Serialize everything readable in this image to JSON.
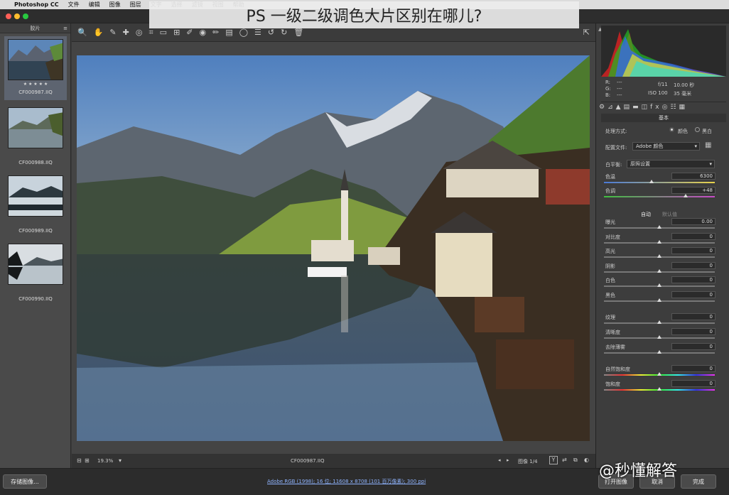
{
  "menubar": {
    "apple": "",
    "app": "Photoshop CC",
    "items": [
      "文件",
      "编辑",
      "图像",
      "图层",
      "文字",
      "选择",
      "滤镜",
      "视图",
      "帮助"
    ]
  },
  "banner": {
    "title": "PS 一级二级调色大片区别在哪儿?"
  },
  "filmstrip": {
    "header": "胶片",
    "stars": "★ ★ ★ ★ ★",
    "items": [
      {
        "label": "CF000987.IIQ",
        "selected": true
      },
      {
        "label": "CF000988.IIQ",
        "selected": false
      },
      {
        "label": "CF000989.IIQ",
        "selected": false
      },
      {
        "label": "CF000990.IIQ",
        "selected": false
      }
    ]
  },
  "toolbar": {
    "icons": [
      "zoom-icon",
      "hand-icon",
      "white-balance-icon",
      "color-sampler-icon",
      "target-adjust-icon",
      "crop-icon",
      "straighten-icon",
      "transform-icon",
      "spot-removal-icon",
      "red-eye-icon",
      "adjustment-brush-icon",
      "graduated-filter-icon",
      "radial-filter-icon",
      "preferences-icon",
      "rotate-left-icon",
      "rotate-right-icon",
      "trash-icon"
    ],
    "glyphs": [
      "🔍",
      "✋",
      "✎",
      "✚",
      "◎",
      "⌗",
      "▭",
      "⊞",
      "✐",
      "◉",
      "✏",
      "▤",
      "◯",
      "☰",
      "↺",
      "↻",
      "🗑"
    ]
  },
  "status": {
    "zoom": "19.3%",
    "filename": "CF000987.IIQ",
    "page": "图像 1/4",
    "nav_prev": "◂",
    "nav_next": "▸"
  },
  "footer": {
    "save": "存储图像...",
    "info": "Adobe RGB (1998); 16 位; 11608 x 8708 (101 百万像素); 300 ppi",
    "open": "打开图像",
    "cancel": "取消",
    "done": "完成"
  },
  "histogram": {
    "r_label": "R:",
    "g_label": "G:",
    "b_label": "B:",
    "r_val": "---",
    "g_val": "---",
    "b_val": "---",
    "aperture": "f/11",
    "shutter": "10.00 秒",
    "iso": "ISO 100",
    "focal": "35 毫米"
  },
  "panel": {
    "section": "基本",
    "process_label": "处理方式:",
    "color_opt": "颜色",
    "bw_opt": "黑白",
    "profile_label": "配置文件:",
    "profile_value": "Adobe 颜色",
    "wb_label": "白平衡:",
    "wb_value": "原照设置",
    "auto": "自动",
    "default": "默认值",
    "sliders": [
      {
        "label": "色温",
        "value": "6300",
        "pos": 0.43
      },
      {
        "label": "色调",
        "value": "+48",
        "pos": 0.74
      },
      {
        "label": "曝光",
        "value": "0.00",
        "pos": 0.5
      },
      {
        "label": "对比度",
        "value": "0",
        "pos": 0.5
      },
      {
        "label": "高光",
        "value": "0",
        "pos": 0.5
      },
      {
        "label": "阴影",
        "value": "0",
        "pos": 0.5
      },
      {
        "label": "白色",
        "value": "0",
        "pos": 0.5
      },
      {
        "label": "黑色",
        "value": "0",
        "pos": 0.5
      },
      {
        "label": "纹理",
        "value": "0",
        "pos": 0.5
      },
      {
        "label": "清晰度",
        "value": "0",
        "pos": 0.5
      },
      {
        "label": "去除薄雾",
        "value": "0",
        "pos": 0.5
      },
      {
        "label": "自然饱和度",
        "value": "0",
        "pos": 0.5
      },
      {
        "label": "饱和度",
        "value": "0",
        "pos": 0.5
      }
    ]
  },
  "watermark": "@秒懂解答"
}
